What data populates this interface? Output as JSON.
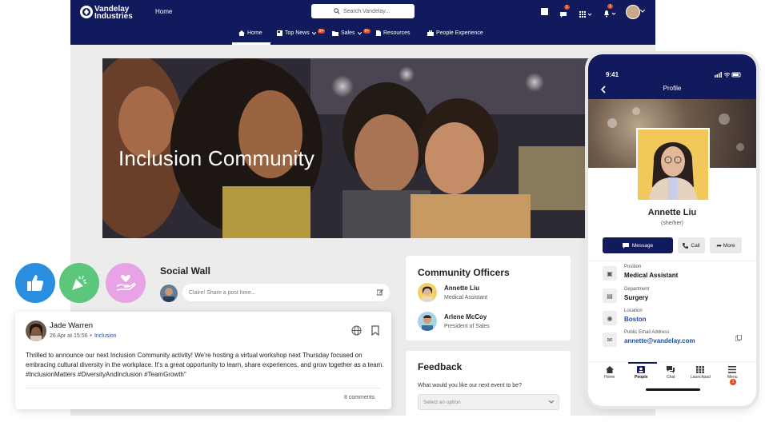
{
  "brand": {
    "name_line1": "Vandelay",
    "name_line2": "Industries"
  },
  "topbar": {
    "home_label": "Home",
    "search_placeholder": "Search Vandelay...",
    "chat_badge": "1",
    "bell_badge": "1"
  },
  "nav": {
    "items": [
      {
        "label": "Home",
        "badge": ""
      },
      {
        "label": "Top News",
        "badge": "9+"
      },
      {
        "label": "Sales",
        "badge": "9+"
      },
      {
        "label": "Resources",
        "badge": ""
      },
      {
        "label": "People Experience",
        "badge": ""
      }
    ]
  },
  "hero": {
    "title": "Inclusion Community"
  },
  "social_wall": {
    "title": "Social Wall",
    "composer_placeholder": "Claire! Share a post here..."
  },
  "post": {
    "author": "Jade Warren",
    "timestamp": "26 Apr at 15:56",
    "separator": "•",
    "community": "Inclusion",
    "body": "Thrilled to announce our next Inclusion Community activity! We're hosting a virtual workshop next Thursday focused on embracing cultural diversity in the workplace. It's a great opportunity to learn, share experiences, and grow together as a team. #InclusionMatters #DiversityAndInclusion #TeamGrowth\"",
    "comments": "8 comments"
  },
  "officers": {
    "title": "Community Officers",
    "people": [
      {
        "name": "Annette Liu",
        "role": "Medical Assistant"
      },
      {
        "name": "Arlene McCoy",
        "role": "President of Sales"
      }
    ]
  },
  "feedback": {
    "title": "Feedback",
    "question": "What would you like our next event to be?",
    "select_placeholder": "Select an option"
  },
  "phone": {
    "time": "9:41",
    "header_title": "Profile",
    "name": "Annette Liu",
    "pronouns": "(she/her)",
    "buttons": {
      "message": "Message",
      "call": "Call",
      "more": "More"
    },
    "fields": [
      {
        "label": "Position",
        "value": "Medical Assistant",
        "icon": "briefcase-icon"
      },
      {
        "label": "Department",
        "value": "Surgery",
        "icon": "building-icon"
      },
      {
        "label": "Location",
        "value": "Boston",
        "icon": "location-pin-icon"
      },
      {
        "label": "Public Email Address",
        "value": "annette@vandelay.com",
        "icon": "mail-icon"
      }
    ],
    "tabs": [
      {
        "label": "Home"
      },
      {
        "label": "People"
      },
      {
        "label": "Chat"
      },
      {
        "label": "Launchpad"
      },
      {
        "label": "Menu",
        "badge": "1"
      }
    ]
  },
  "colors": {
    "navy": "#111a5c",
    "badge": "#e84a1a",
    "link": "#1d4fa8",
    "like": "#2a8ee0",
    "celebrate": "#5cc67a",
    "love": "#e7a3e6"
  }
}
